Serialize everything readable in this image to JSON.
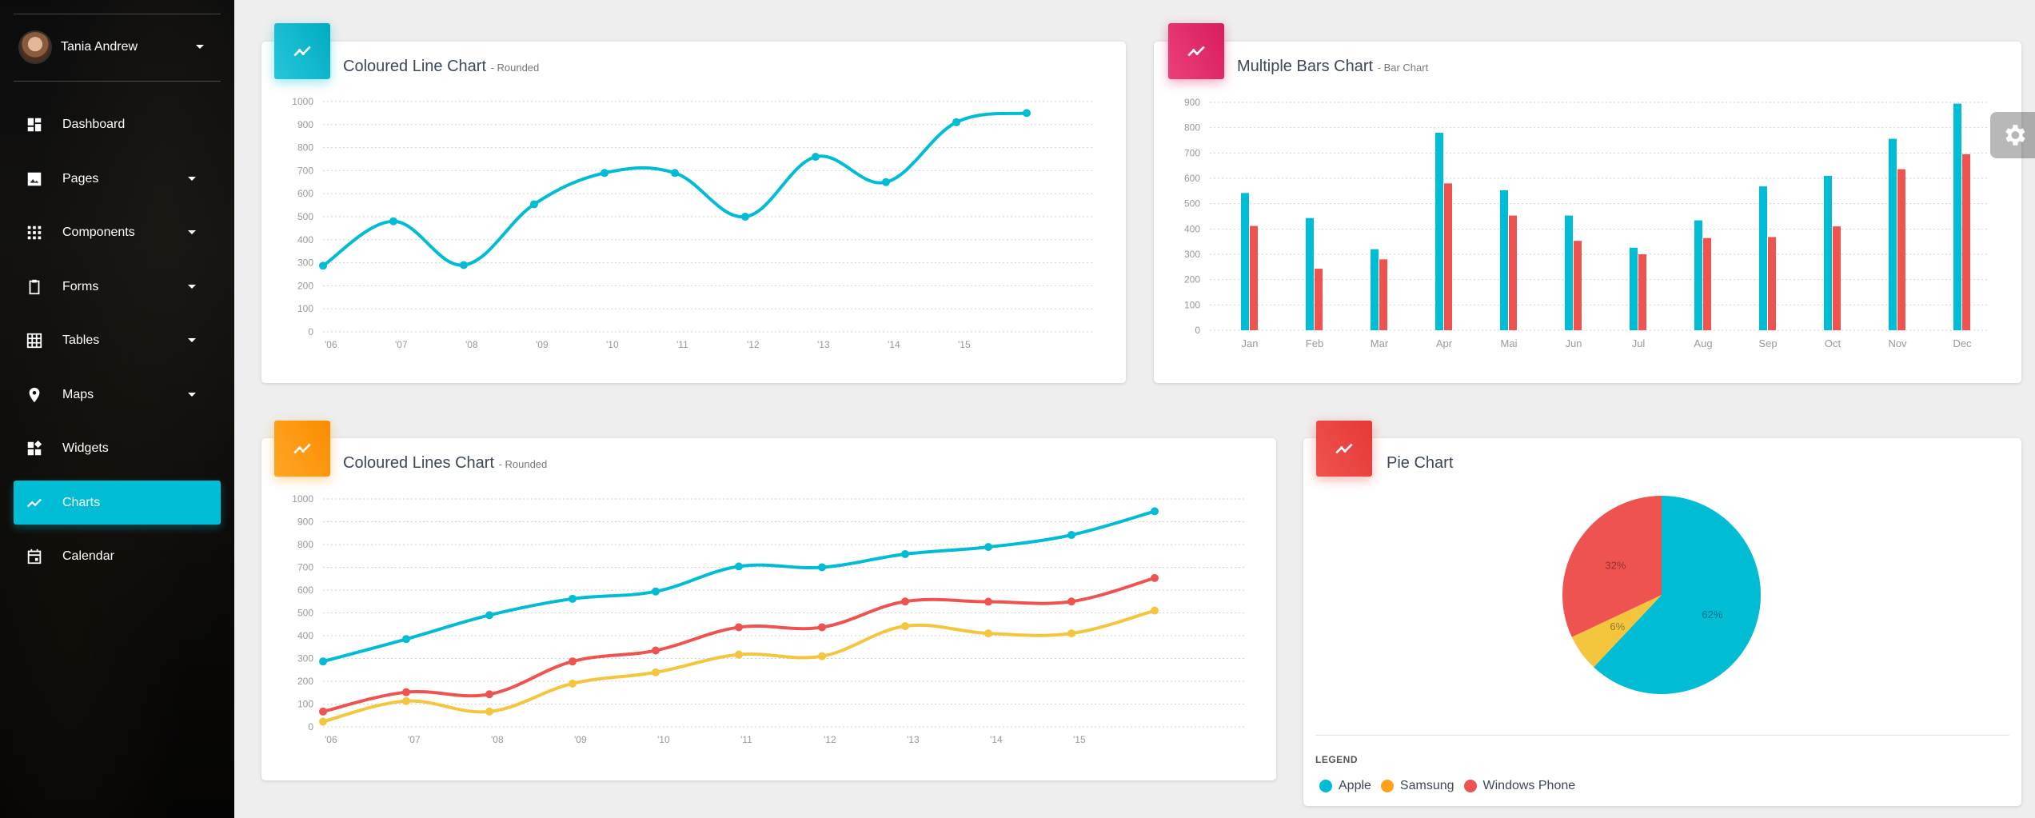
{
  "sidebar": {
    "user_name": "Tania Andrew",
    "items": [
      {
        "label": "Dashboard",
        "icon": "dashboard-icon",
        "caret": false,
        "active": false
      },
      {
        "label": "Pages",
        "icon": "image-icon",
        "caret": true,
        "active": false
      },
      {
        "label": "Components",
        "icon": "apps-icon",
        "caret": true,
        "active": false
      },
      {
        "label": "Forms",
        "icon": "clipboard-icon",
        "caret": true,
        "active": false
      },
      {
        "label": "Tables",
        "icon": "grid-icon",
        "caret": true,
        "active": false
      },
      {
        "label": "Maps",
        "icon": "place-icon",
        "caret": true,
        "active": false
      },
      {
        "label": "Widgets",
        "icon": "widgets-icon",
        "caret": false,
        "active": false
      },
      {
        "label": "Charts",
        "icon": "timeline-icon",
        "caret": false,
        "active": true
      },
      {
        "label": "Calendar",
        "icon": "calendar-icon",
        "caret": false,
        "active": false
      }
    ]
  },
  "colors": {
    "cyan": "#00bcd4",
    "red": "#ef5350",
    "yellow": "#f4c63d",
    "orange": "#ffa21a",
    "pink": "#e91e63"
  },
  "cards": {
    "line": {
      "title": "Coloured Line Chart",
      "subtitle": "- Rounded"
    },
    "bars": {
      "title": "Multiple Bars Chart",
      "subtitle": "- Bar Chart"
    },
    "lines": {
      "title": "Coloured Lines Chart",
      "subtitle": "- Rounded"
    },
    "pie": {
      "title": "Pie Chart",
      "legend_title": "LEGEND",
      "legend": [
        "Apple",
        "Samsung",
        "Windows Phone"
      ]
    }
  },
  "chart_data": [
    {
      "type": "line",
      "title": "Coloured Line Chart",
      "categories": [
        "'06",
        "'07",
        "'08",
        "'09",
        "'10",
        "'11",
        "'12",
        "'13",
        "'14",
        "'15"
      ],
      "ylim": [
        0,
        1000
      ],
      "yticks": [
        0,
        100,
        200,
        300,
        400,
        500,
        600,
        700,
        800,
        900,
        1000
      ],
      "series": [
        {
          "values": [
            287,
            480,
            290,
            554,
            690,
            690,
            500,
            760,
            650,
            910,
            950
          ]
        }
      ],
      "grid": true
    },
    {
      "type": "bar",
      "title": "Multiple Bars Chart",
      "categories": [
        "Jan",
        "Feb",
        "Mar",
        "Apr",
        "Mai",
        "Jun",
        "Jul",
        "Aug",
        "Sep",
        "Oct",
        "Nov",
        "Dec"
      ],
      "ylim": [
        0,
        900
      ],
      "yticks": [
        0,
        100,
        200,
        300,
        400,
        500,
        600,
        700,
        800,
        900
      ],
      "series": [
        {
          "values": [
            542,
            443,
            320,
            780,
            553,
            453,
            326,
            434,
            568,
            610,
            756,
            895
          ]
        },
        {
          "values": [
            412,
            243,
            280,
            580,
            453,
            353,
            300,
            364,
            368,
            410,
            636,
            695
          ]
        }
      ],
      "grid": true
    },
    {
      "type": "line",
      "title": "Coloured Lines Chart",
      "categories": [
        "'06",
        "'07",
        "'08",
        "'09",
        "'10",
        "'11",
        "'12",
        "'13",
        "'14",
        "'15"
      ],
      "ylim": [
        0,
        1000
      ],
      "yticks": [
        0,
        100,
        200,
        300,
        400,
        500,
        600,
        700,
        800,
        900,
        1000
      ],
      "series": [
        {
          "values": [
            287,
            385,
            490,
            562,
            594,
            704,
            700,
            758,
            789,
            842,
            946
          ]
        },
        {
          "values": [
            67,
            152,
            143,
            287,
            335,
            437,
            437,
            550,
            549,
            550,
            653
          ]
        },
        {
          "values": [
            23,
            113,
            67,
            190,
            239,
            317,
            310,
            442,
            410,
            410,
            510
          ]
        }
      ],
      "grid": true
    },
    {
      "type": "pie",
      "title": "Pie Chart",
      "labels": [
        "Apple",
        "Samsung",
        "Windows Phone"
      ],
      "values": [
        62,
        6,
        32
      ],
      "display_labels": [
        "62%",
        "6%",
        "32%"
      ],
      "legend_position": "bottom"
    }
  ]
}
